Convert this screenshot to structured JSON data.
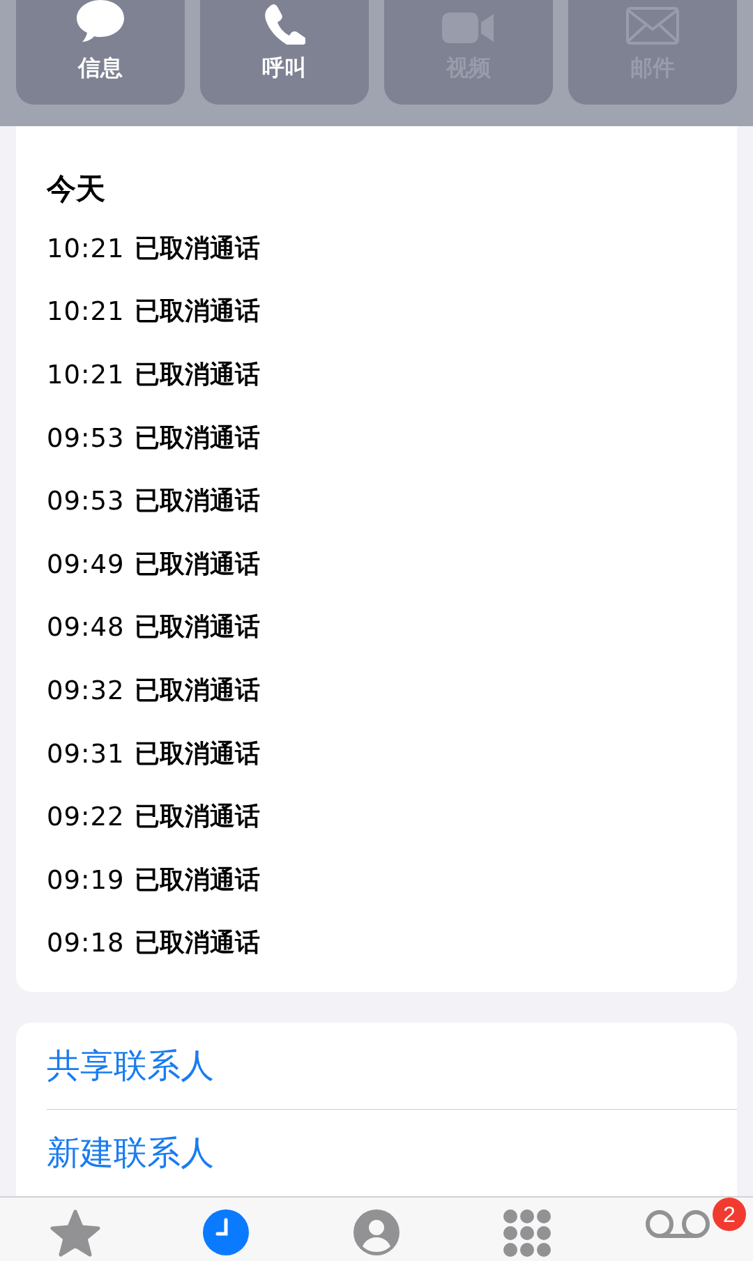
{
  "actions": [
    {
      "label": "信息",
      "kind": "message",
      "disabled": false
    },
    {
      "label": "呼叫",
      "kind": "phone",
      "disabled": false
    },
    {
      "label": "视频",
      "kind": "video",
      "disabled": true
    },
    {
      "label": "邮件",
      "kind": "mail",
      "disabled": true
    }
  ],
  "recents": {
    "heading": "今天",
    "calls": [
      {
        "time": "10:21",
        "status": "已取消通话"
      },
      {
        "time": "10:21",
        "status": "已取消通话"
      },
      {
        "time": "10:21",
        "status": "已取消通话"
      },
      {
        "time": "09:53",
        "status": "已取消通话"
      },
      {
        "time": "09:53",
        "status": "已取消通话"
      },
      {
        "time": "09:49",
        "status": "已取消通话"
      },
      {
        "time": "09:48",
        "status": "已取消通话"
      },
      {
        "time": "09:32",
        "status": "已取消通话"
      },
      {
        "time": "09:31",
        "status": "已取消通话"
      },
      {
        "time": "09:22",
        "status": "已取消通话"
      },
      {
        "time": "09:19",
        "status": "已取消通话"
      },
      {
        "time": "09:18",
        "status": "已取消通话"
      }
    ]
  },
  "links": [
    "共享联系人",
    "新建联系人"
  ],
  "tab_bar": [
    {
      "kind": "favorites",
      "selected": false
    },
    {
      "kind": "recents",
      "selected": true
    },
    {
      "kind": "contacts",
      "selected": false
    },
    {
      "kind": "keypad",
      "selected": false
    },
    {
      "kind": "voicemail",
      "selected": false,
      "badge": "2"
    }
  ]
}
